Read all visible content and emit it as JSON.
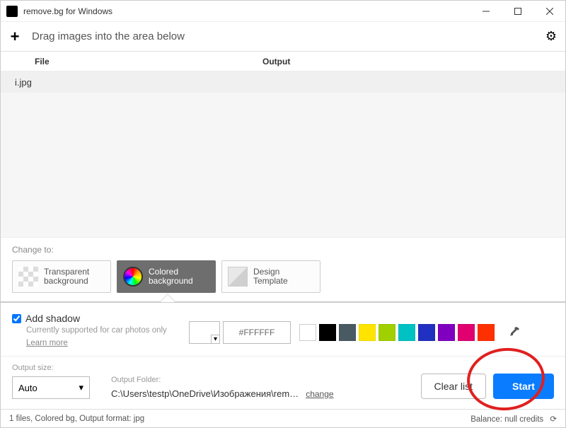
{
  "window": {
    "title": "remove.bg for Windows"
  },
  "toolbar": {
    "drag_hint": "Drag images into the area below"
  },
  "table": {
    "headers": {
      "file": "File",
      "output": "Output"
    },
    "rows": [
      {
        "file": "i.jpg",
        "output": ""
      }
    ]
  },
  "change_to": {
    "label": "Change to:",
    "options": [
      {
        "key": "transparent",
        "label": "Transparent background",
        "selected": false
      },
      {
        "key": "colored",
        "label": "Colored background",
        "selected": true
      },
      {
        "key": "template",
        "label": "Design Template",
        "selected": false
      }
    ]
  },
  "shadow": {
    "checked": true,
    "title": "Add shadow",
    "desc": "Currently supported for car photos only",
    "learn": "Learn more"
  },
  "color": {
    "hex": "#FFFFFF",
    "swatches": [
      "#FFFFFF",
      "#000000",
      "#4a5a63",
      "#ffe400",
      "#a0d000",
      "#00c2c2",
      "#2030c0",
      "#8000c0",
      "#e00070",
      "#ff3000"
    ]
  },
  "output_size": {
    "label": "Output size:",
    "value": "Auto"
  },
  "output_folder": {
    "label": "Output Folder:",
    "path": "C:\\Users\\testp\\OneDrive\\Изображения\\rem…",
    "change": "change"
  },
  "actions": {
    "clear": "Clear list",
    "start": "Start"
  },
  "status": {
    "left": "1 files, Colored bg, Output format: jpg",
    "right": "Balance: null credits"
  }
}
